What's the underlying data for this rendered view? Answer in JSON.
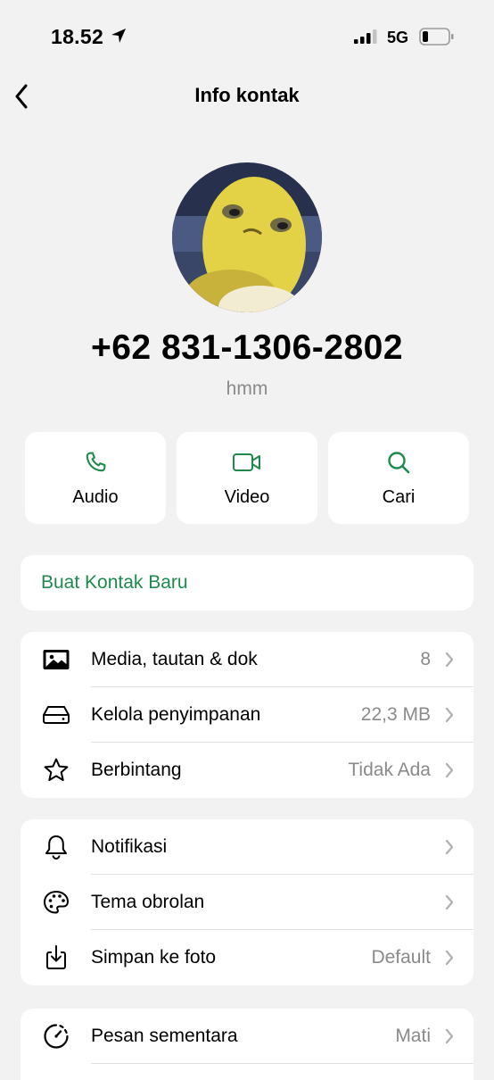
{
  "status_bar": {
    "time": "18.52",
    "network": "5G"
  },
  "nav": {
    "title": "Info kontak"
  },
  "contact": {
    "name": "+62 831-1306-2802",
    "about": "hmm"
  },
  "actions": [
    {
      "label": "Audio",
      "icon": "phone-icon"
    },
    {
      "label": "Video",
      "icon": "video-icon"
    },
    {
      "label": "Cari",
      "icon": "search-icon"
    }
  ],
  "new_contact_label": "Buat Kontak Baru",
  "group1": [
    {
      "label": "Media, tautan & dok",
      "value": "8",
      "icon": "image-icon"
    },
    {
      "label": "Kelola penyimpanan",
      "value": "22,3 MB",
      "icon": "storage-icon"
    },
    {
      "label": "Berbintang",
      "value": "Tidak Ada",
      "icon": "star-icon"
    }
  ],
  "group2": [
    {
      "label": "Notifikasi",
      "value": "",
      "icon": "bell-icon"
    },
    {
      "label": "Tema obrolan",
      "value": "",
      "icon": "palette-icon"
    },
    {
      "label": "Simpan ke foto",
      "value": "Default",
      "icon": "download-icon"
    }
  ],
  "group3": [
    {
      "label": "Pesan sementara",
      "value": "Mati",
      "icon": "timer-icon"
    }
  ],
  "colors": {
    "accent": "#1f8a4c",
    "background": "#f2f2f2",
    "secondary_text": "#8a8a8a"
  }
}
